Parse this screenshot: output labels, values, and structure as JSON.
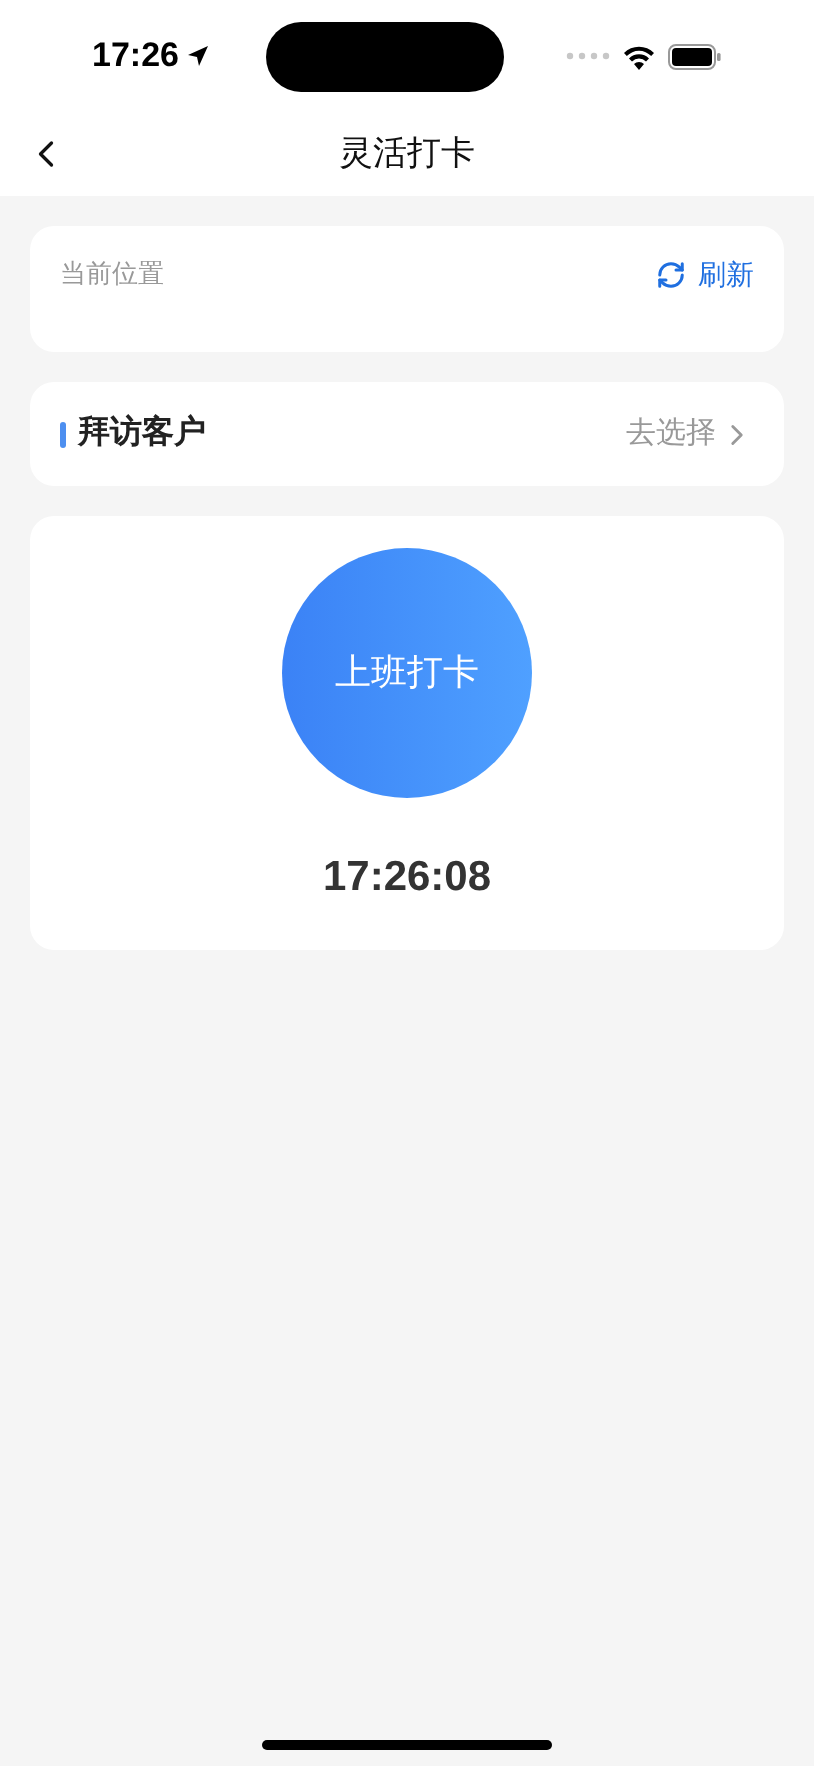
{
  "status_bar": {
    "time": "17:26"
  },
  "nav": {
    "title": "灵活打卡"
  },
  "location": {
    "label": "当前位置",
    "action": "刷新"
  },
  "visit": {
    "label": "拜访客户",
    "action": "去选择"
  },
  "clock_in": {
    "button": "上班打卡",
    "time": "17:26:08"
  }
}
